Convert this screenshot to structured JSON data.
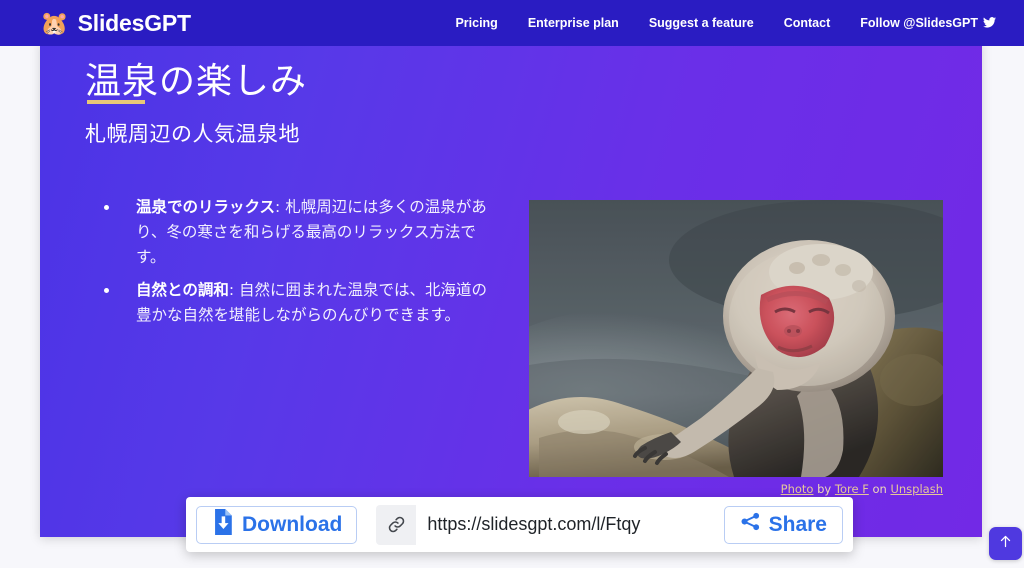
{
  "navbar": {
    "brand_emoji": "🐹",
    "brand_icon_name": "hamster-logo-icon",
    "brand_text": "SlidesGPT",
    "background_color": "#2a1cc2",
    "links": [
      {
        "label": "Pricing"
      },
      {
        "label": "Enterprise plan"
      },
      {
        "label": "Suggest a feature"
      },
      {
        "label": "Contact"
      },
      {
        "label": "Follow @SlidesGPT"
      }
    ],
    "twitter_glyph": "🐦"
  },
  "slide": {
    "title": "温泉の楽しみ",
    "subtitle": "札幌周辺の人気温泉地",
    "accent_rule_color": "#e8c778",
    "background_gradient_start": "#4b33e6",
    "background_gradient_end": "#7229e6",
    "bullets": [
      {
        "lead": "温泉でのリラックス",
        "separator": ": ",
        "body": "札幌周辺には多くの温泉があり、冬の寒さを和らげる最高のリラックス方法です。"
      },
      {
        "lead": "自然との調和",
        "separator": ": ",
        "body": "自然に囲まれた温泉では、北海道の豊かな自然を堪能しながらのんびりできます。"
      }
    ],
    "image": {
      "alt": "snow monkey bathing in hot spring",
      "credit": {
        "prefix": "Photo",
        "by": "by",
        "author": "Tore F",
        "on": "on",
        "source": "Unsplash"
      }
    }
  },
  "action_bar": {
    "download_label": "Download",
    "download_icon": "file-download-icon",
    "link_icon": "link-icon",
    "url_value": "https://slidesgpt.com/l/Ftqy",
    "url_placeholder": "https://slidesgpt.com/l/",
    "share_label": "Share",
    "share_icon": "share-nodes-icon"
  },
  "scroll_top": {
    "icon": "arrow-up-icon",
    "glyph": "↑",
    "color": "#4f39e0"
  }
}
